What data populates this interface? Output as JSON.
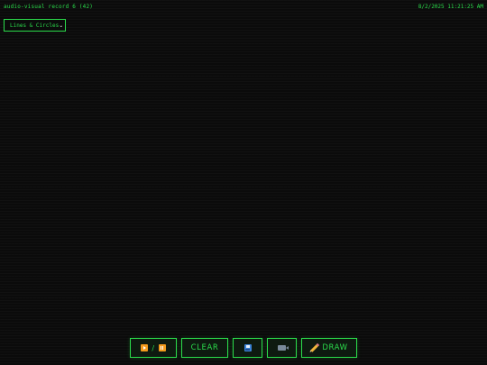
{
  "header": {
    "label": "audio-visual record 6 (42)",
    "timestamp": "8/2/2025 11:21:25 AM"
  },
  "mode_select": {
    "value": "Lines & Circles",
    "chevron_icon": "chevron-down-icon"
  },
  "toolbar": {
    "play_pause": {
      "separator": "/",
      "icons": [
        "play-icon",
        "pause-icon"
      ]
    },
    "clear_label": "CLEAR",
    "save_icon": "floppy-disk-icon",
    "record_icon": "video-camera-icon",
    "draw_label": "DRAW",
    "draw_icon": "pencil-icon"
  },
  "colors": {
    "background": "#0b0b0b",
    "accent_green": "#2bdc4b",
    "icon_orange": "#f29a1c"
  }
}
